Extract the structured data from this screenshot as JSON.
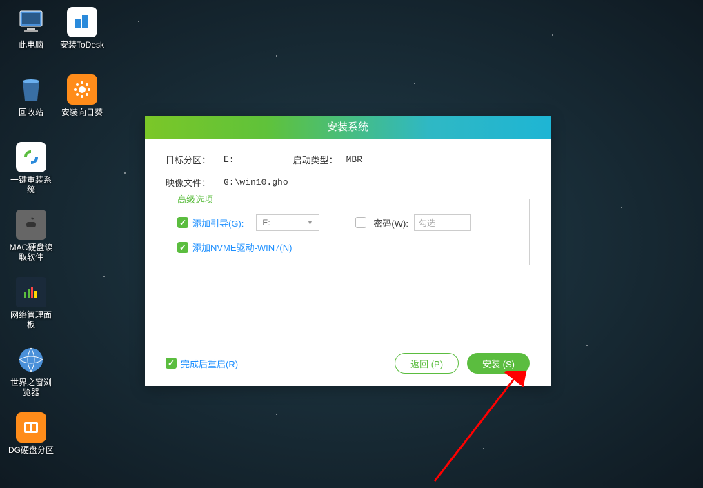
{
  "desktop": {
    "icons": [
      {
        "label": "此电脑",
        "bg": "transparent"
      },
      {
        "label": "安装ToDesk",
        "bg": "#fff"
      },
      {
        "label": "回收站",
        "bg": "transparent"
      },
      {
        "label": "安装向日葵",
        "bg": "#ff8c1a"
      },
      {
        "label": "一键重装系统",
        "bg": "#fff"
      },
      {
        "label": "MAC硬盘读取软件",
        "bg": "#555"
      },
      {
        "label": "网络管理面板",
        "bg": "#1a2a3a"
      },
      {
        "label": "世界之窗浏览器",
        "bg": "transparent"
      },
      {
        "label": "DG硬盘分区",
        "bg": "#ff8c1a"
      }
    ]
  },
  "dialog": {
    "title": "安装系统",
    "target_partition_label": "目标分区：",
    "target_partition_value": "E:",
    "boot_type_label": "启动类型：",
    "boot_type_value": "MBR",
    "image_file_label": "映像文件：",
    "image_file_value": "G:\\win10.gho",
    "advanced_legend": "高级选项",
    "add_boot_label": "添加引导(G):",
    "add_boot_value": "E:",
    "password_label": "密码(W):",
    "password_placeholder": "勾选",
    "add_nvme_label": "添加NVME驱动-WIN7(N)",
    "restart_after_label": "完成后重启(R)",
    "back_button": "返回 (P)",
    "install_button": "安装 (S)"
  }
}
